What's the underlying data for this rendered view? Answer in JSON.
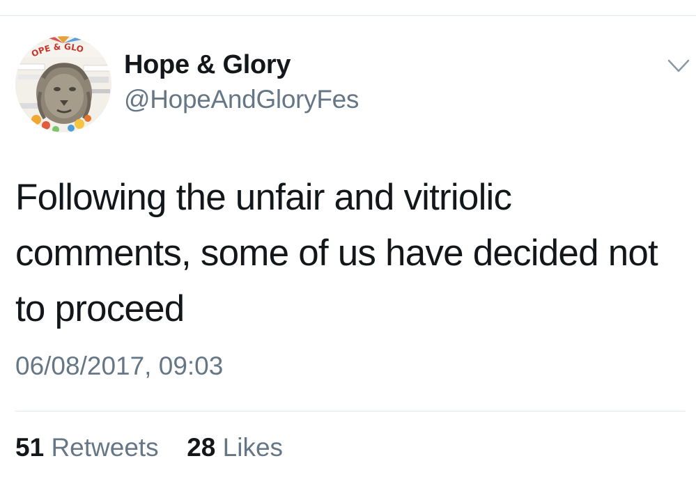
{
  "tweet": {
    "author": {
      "name": "Hope & Glory",
      "handle": "@HopeAndGloryFes",
      "avatar_logo_text": "OPE & GLO"
    },
    "text": "Following the unfair and vitriolic comments, some of us have decided not to proceed",
    "timestamp": "06/08/2017, 09:03",
    "stats": {
      "retweets_count": "51",
      "retweets_label": "Retweets",
      "likes_count": "28",
      "likes_label": "Likes"
    }
  },
  "colors": {
    "text_primary": "#14171a",
    "text_secondary": "#657786",
    "divider": "#e1e8ed",
    "logo_red": "#c8352b"
  },
  "icons": {
    "menu": "chevron-down-icon"
  }
}
